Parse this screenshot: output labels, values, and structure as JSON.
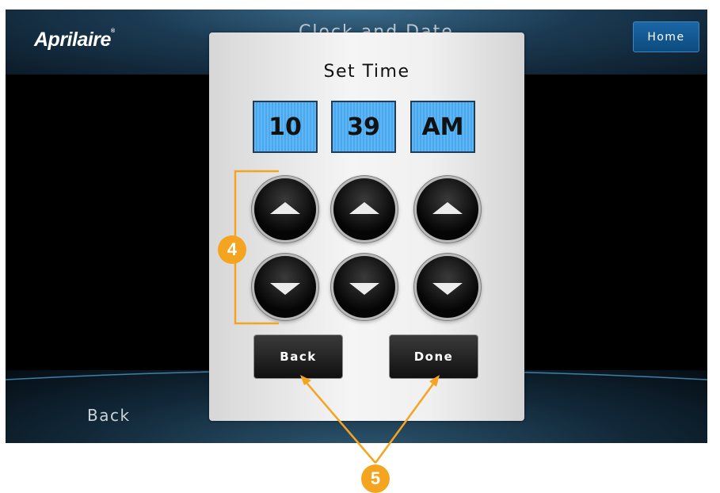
{
  "header": {
    "logo_text": "Aprilaire",
    "logo_mark": "®",
    "background_title": "Clock and Date",
    "home_label": "Home"
  },
  "background": {
    "back_label": "Back"
  },
  "dialog": {
    "title": "Set Time",
    "fields": {
      "hour": "10",
      "minute": "39",
      "period": "AM"
    },
    "back_label": "Back",
    "done_label": "Done"
  },
  "annotations": {
    "callout_4": "4",
    "callout_5": "5"
  },
  "colors": {
    "field_blue": "#4aa8ee",
    "callout_orange": "#f5a41f",
    "home_blue": "#0d4b7e"
  },
  "icons": {
    "increment": "triangle-up-icon",
    "decrement": "triangle-down-icon"
  }
}
